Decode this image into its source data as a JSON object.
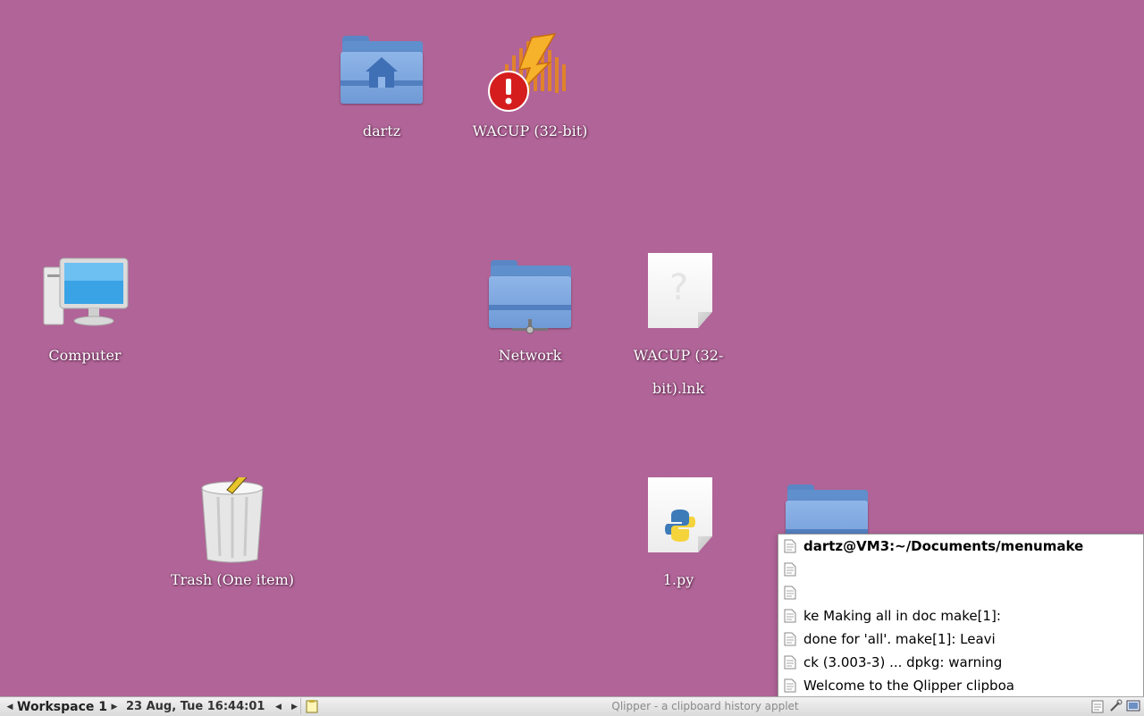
{
  "desktop": {
    "icons": [
      {
        "id": "dartz",
        "label": "dartz",
        "icon": "home-folder-icon"
      },
      {
        "id": "wacup",
        "label": "WACUP (32-bit)",
        "icon": "wacup-broken-link-icon"
      },
      {
        "id": "computer",
        "label": "Computer",
        "icon": "computer-icon"
      },
      {
        "id": "network",
        "label": "Network",
        "icon": "network-folder-icon"
      },
      {
        "id": "wacup-lnk",
        "label": "WACUP (32-bit).lnk",
        "icon": "unknown-file-icon"
      },
      {
        "id": "trash",
        "label": "Trash (One item)",
        "icon": "trash-full-icon"
      },
      {
        "id": "py",
        "label": "1.py",
        "icon": "python-file-icon"
      },
      {
        "id": "folder",
        "label": "",
        "icon": "folder-icon"
      }
    ]
  },
  "clip_menu": {
    "items": [
      {
        "text": "dartz@VM3:~/Documents/menumake",
        "bold": true
      },
      {
        "text": ""
      },
      {
        "text": ""
      },
      {
        "text": "ke Making all in doc make[1]:"
      },
      {
        "text": "done for 'all'. make[1]: Leavi"
      },
      {
        "text": "ck (3.003-3) ... dpkg: warning"
      },
      {
        "text": "Welcome to the Qlipper clipboa"
      }
    ]
  },
  "taskbar": {
    "workspace": "Workspace 1",
    "clock": "23 Aug, Tue 16:44:01",
    "task_title": "Qlipper - a clipboard history applet"
  },
  "colors": {
    "desktop_bg": "#b06497",
    "folder_blue": "#6f9ad6"
  }
}
